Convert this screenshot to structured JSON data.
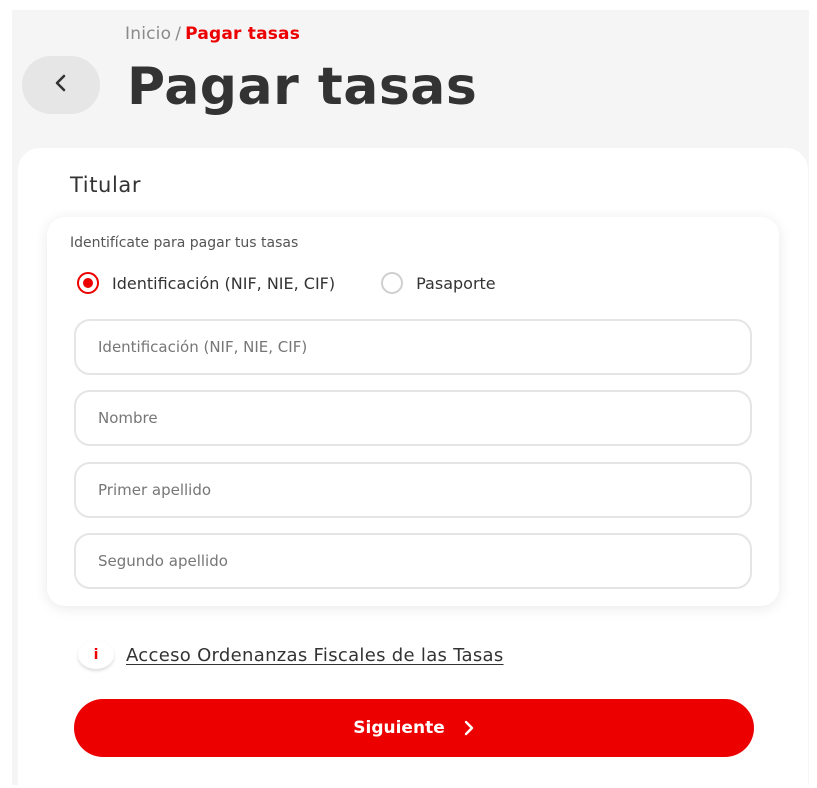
{
  "breadcrumb": {
    "home": "Inicio",
    "separator": "/",
    "current": "Pagar tasas"
  },
  "header": {
    "back_icon": "chevron-left-icon",
    "title": "Pagar tasas"
  },
  "form": {
    "section_title": "Titular",
    "instruction": "Identifícate para pagar tus tasas",
    "id_type_options": [
      {
        "label": "Identificación (NIF, NIE, CIF)",
        "selected": true
      },
      {
        "label": "Pasaporte",
        "selected": false
      }
    ],
    "fields": {
      "identificacion": {
        "placeholder": "Identificación (NIF, NIE, CIF)",
        "value": ""
      },
      "nombre": {
        "placeholder": "Nombre",
        "value": ""
      },
      "primer_apellido": {
        "placeholder": "Primer apellido",
        "value": ""
      },
      "segundo_apellido": {
        "placeholder": "Segundo apellido",
        "value": ""
      }
    }
  },
  "info": {
    "icon": "info-icon",
    "icon_glyph": "i",
    "link_text": "Acceso Ordenanzas Fiscales de las Tasas"
  },
  "actions": {
    "next_label": "Siguiente",
    "next_icon": "chevron-right-icon"
  },
  "colors": {
    "accent": "#ec0000",
    "text": "#333333",
    "muted": "#8a8a8a",
    "background": "#f5f5f5"
  }
}
